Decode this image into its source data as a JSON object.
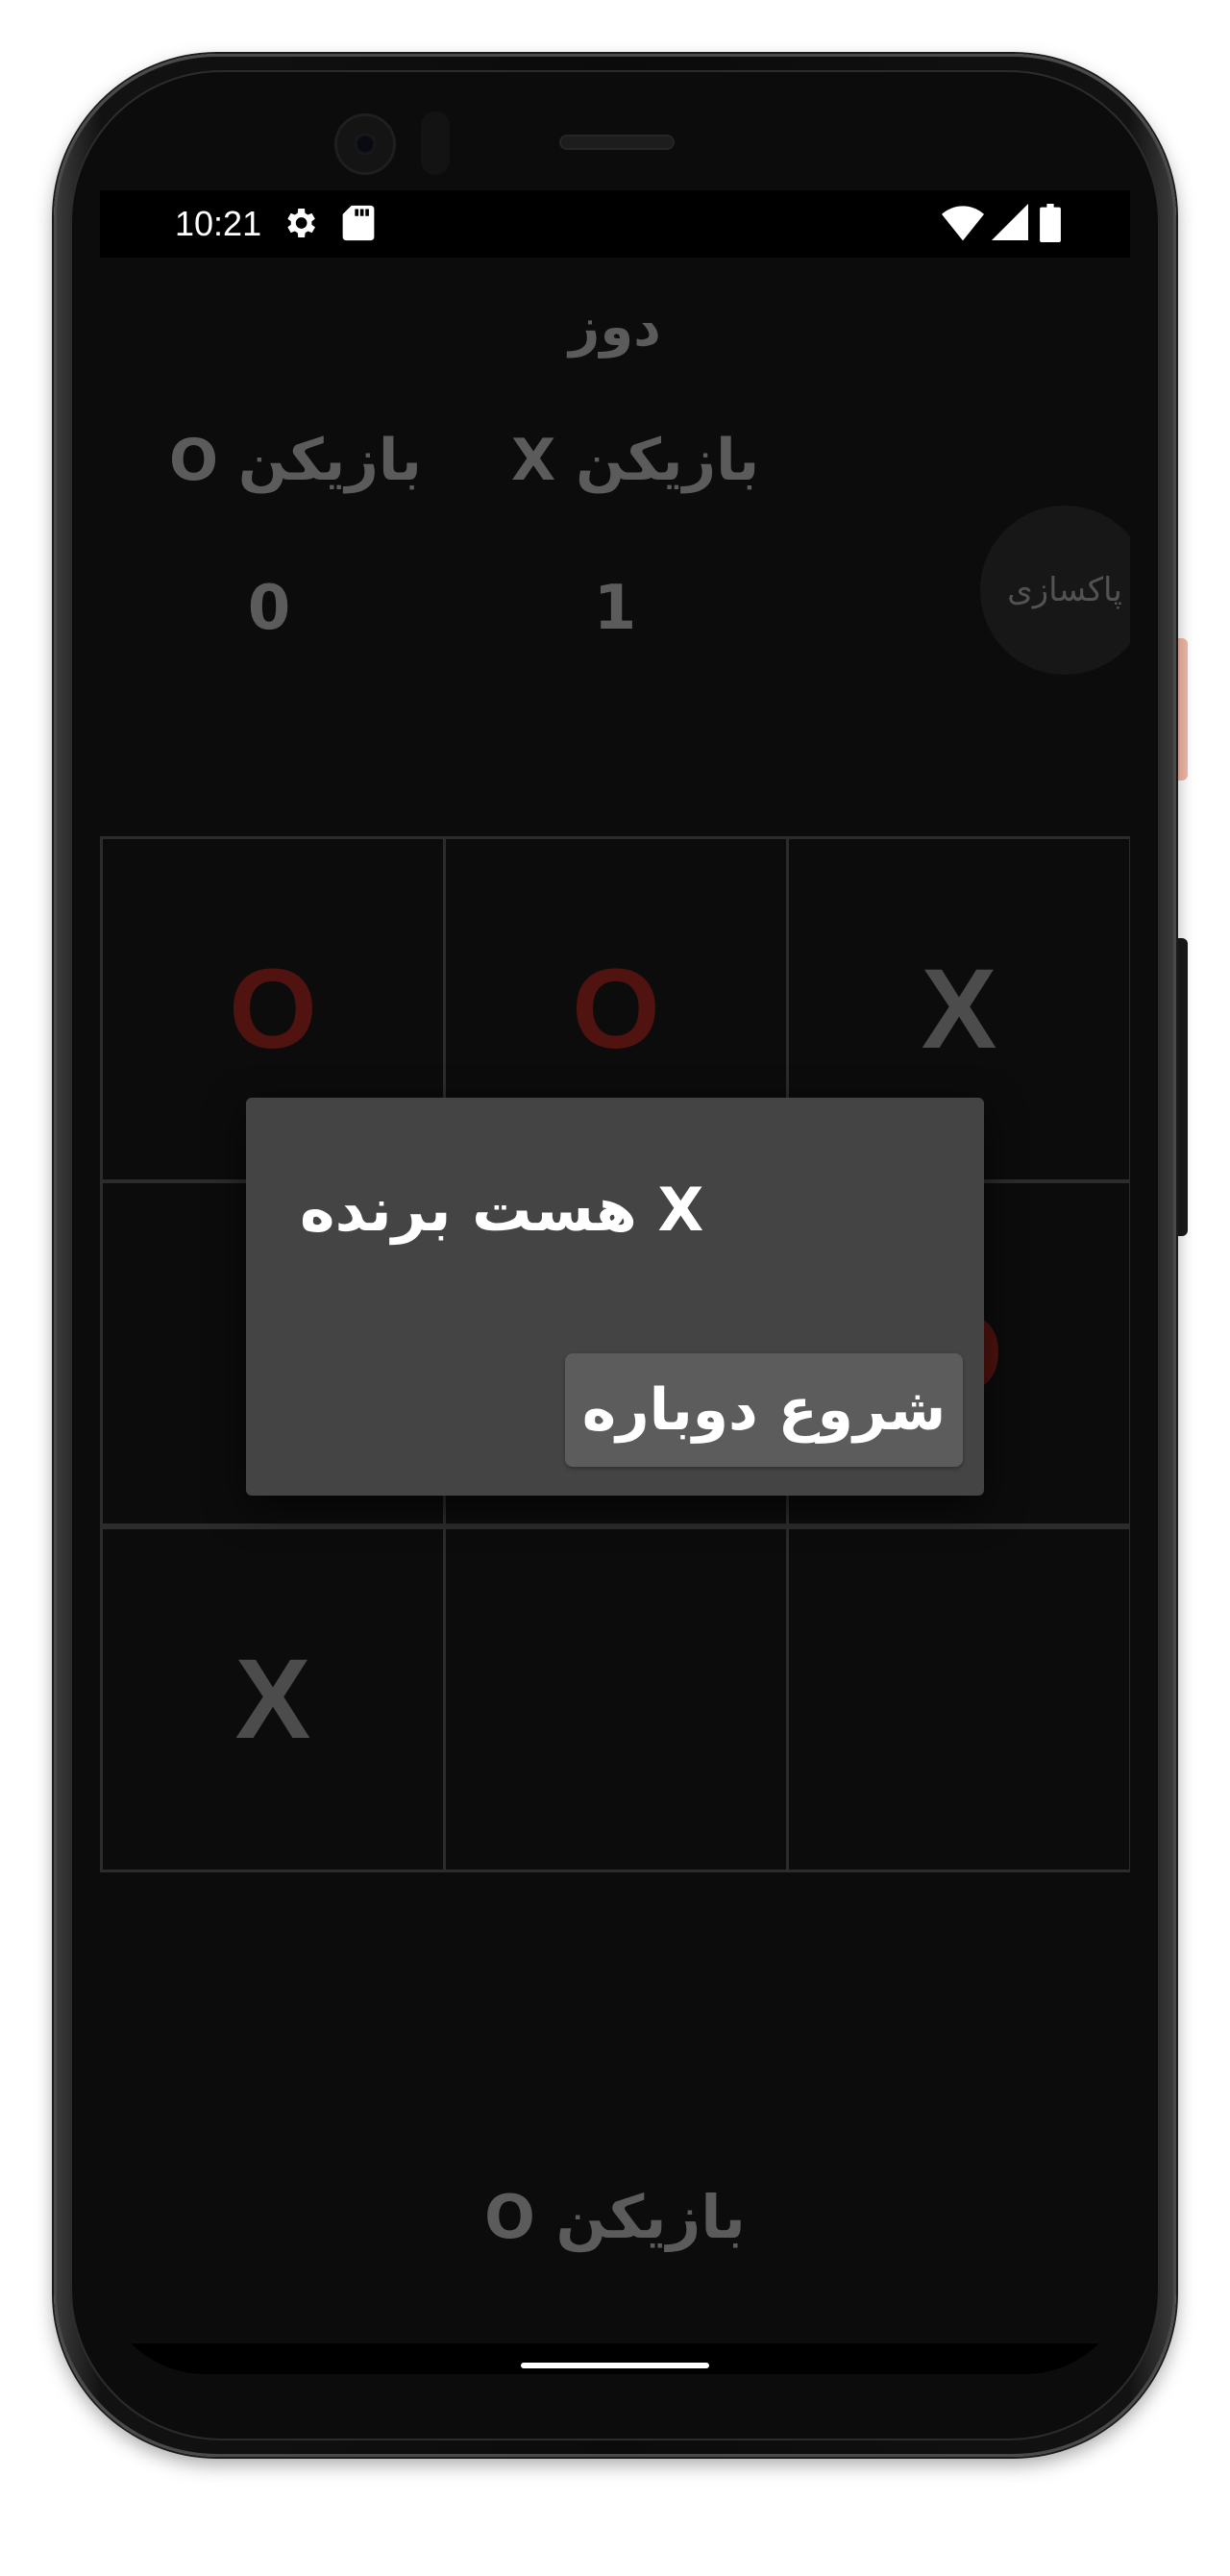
{
  "status_bar": {
    "time": "10:21",
    "icons": [
      "settings-icon",
      "sd-card-icon",
      "wifi-icon",
      "cell-signal-icon",
      "battery-icon"
    ]
  },
  "app": {
    "title": "دوز",
    "player_x_label": "بازیکن X",
    "player_o_label": "بازیکن O",
    "player_x_score": "1",
    "player_o_score": "0",
    "reset_label": "پاکسازی",
    "board": [
      [
        "O",
        "O",
        "X"
      ],
      [
        "",
        "",
        "O"
      ],
      [
        "X",
        "",
        ""
      ]
    ],
    "current_turn": "بازیکن O"
  },
  "dialog": {
    "title": "X هست برنده",
    "restart_label": "شروع دوباره"
  },
  "colors": {
    "background": "#111111",
    "x_mark": "#666666",
    "o_mark": "#6b1a14",
    "dialog": "#444444",
    "dialog_button": "#5c5c5c"
  }
}
